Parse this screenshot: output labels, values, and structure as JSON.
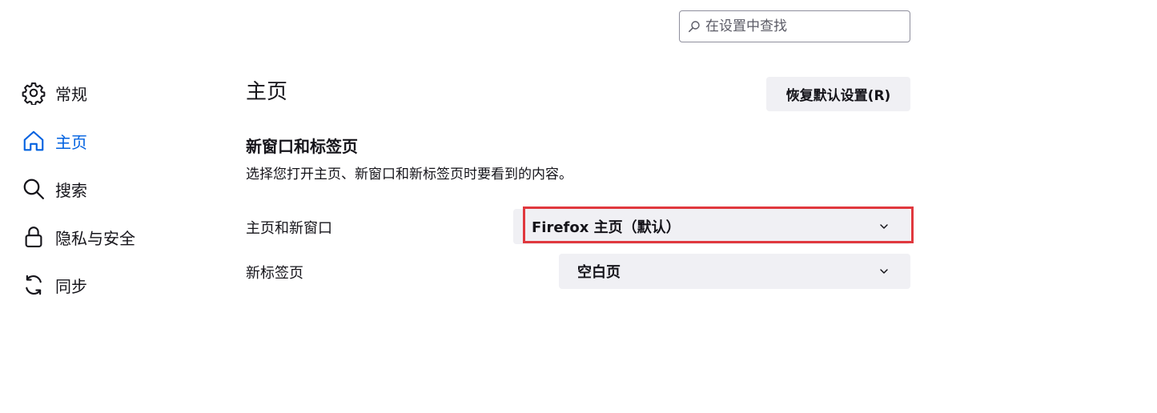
{
  "search": {
    "placeholder": "在设置中查找"
  },
  "sidebar": {
    "items": [
      {
        "label": "常规",
        "icon": "gear-icon"
      },
      {
        "label": "主页",
        "icon": "home-icon",
        "active": true
      },
      {
        "label": "搜索",
        "icon": "search-icon"
      },
      {
        "label": "隐私与安全",
        "icon": "lock-icon"
      },
      {
        "label": "同步",
        "icon": "sync-icon"
      }
    ]
  },
  "main": {
    "title": "主页",
    "restore_button": "恢复默认设置(R)",
    "section_title": "新窗口和标签页",
    "section_desc": "选择您打开主页、新窗口和新标签页时要看到的内容。",
    "rows": [
      {
        "label": "主页和新窗口",
        "value": "Firefox 主页（默认）"
      },
      {
        "label": "新标签页",
        "value": "空白页"
      }
    ]
  },
  "colors": {
    "accent": "#0061e0",
    "highlight": "#e0383e",
    "control_bg": "#f0f0f4"
  }
}
